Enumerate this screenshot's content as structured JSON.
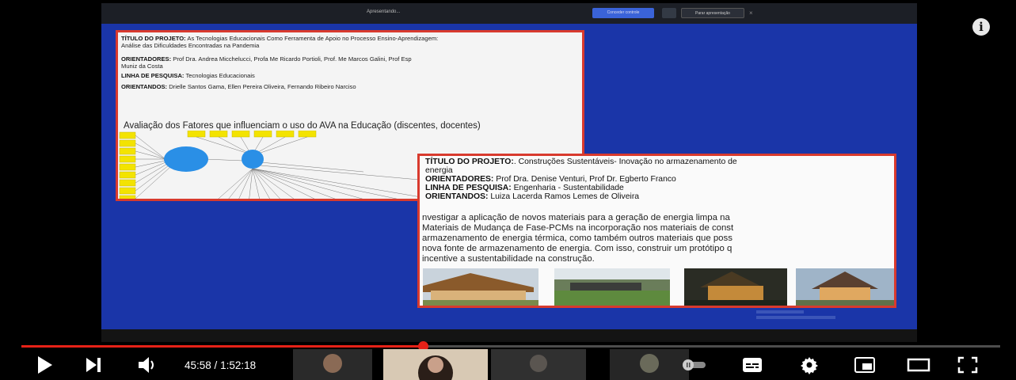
{
  "meeting_toolbar": {
    "presenting_label": "Apresentando...",
    "stop_presenting_label": "Conceder controle",
    "share_label": "Parar apresentação",
    "close_glyph": "×"
  },
  "info": {
    "icon": "info-icon",
    "glyph": "i"
  },
  "slide1": {
    "title_label": "TÍTULO DO PROJETO:",
    "title_value": " As Tecnologias Educacionais Como Ferramenta de Apoio no Processo Ensino-Aprendizagem:",
    "title_value_2": "Análise das Dificuldades Encontradas na Pandemia",
    "advisors_label": "ORIENTADORES:",
    "advisors_value": " Prof Dra. Andrea Micchelucci, Profa Me Ricardo Portioli, Prof. Me Marcos Galini, Prof Esp",
    "advisors_value_2": "Muniz da Costa",
    "research_line_label": "LINHA DE PESQUISA:",
    "research_line_value": " Tecnologias Educacionais",
    "students_label": "ORIENTANDOS:",
    "students_value": " Drielle Santos Gama, Ellen Pereira Oliveira, Fernando Ribeiro Narciso",
    "heading": "Avaliação dos Fatores que influenciam o uso do AVA na Educação (discentes, docentes)"
  },
  "slide2": {
    "title_label": "TÍTULO DO PROJETO:",
    "title_value": ". Construções Sustentáveis- Inovação no armazenamento de",
    "title_value_2": "energia",
    "advisors_label": "ORIENTADORES:",
    "advisors_value": " Prof Dra. Denise Venturi, Prof Dr. Egberto Franco",
    "research_line_label": "LINHA DE PESQUISA:",
    "research_line_value": " Engenharia - Sustentabilidade",
    "students_label": "ORIENTANDOS:",
    "students_value": " Luiza Lacerda Ramos Lemes de Oliveira",
    "paragraph": [
      "nvestigar a aplicação de novos materiais para a geração de energia limpa na",
      "Materiais de Mudança de Fase-PCMs na incorporação nos materiais de const",
      "armazenamento de energia térmica, como também outros materiais que poss",
      "nova fonte de armazenamento de energia. Com isso, construir um protótipo q",
      "incentive a sustentabilidade na construção."
    ]
  },
  "player": {
    "current_time": "45:58",
    "separator": " / ",
    "duration": "1:52:18",
    "progress_fraction": 0.41,
    "controls": {
      "play": "play-icon",
      "next": "next-icon",
      "volume": "volume-icon",
      "autoplay": "autoplay-toggle-icon",
      "subtitles": "subtitles-icon",
      "settings": "gear-icon",
      "miniplayer": "miniplayer-icon",
      "theater": "theater-mode-icon",
      "fullscreen": "fullscreen-icon"
    }
  },
  "colors": {
    "stage_blue": "#1a35a8",
    "progress_red": "#e62117",
    "slide_border": "#d83a2e"
  }
}
